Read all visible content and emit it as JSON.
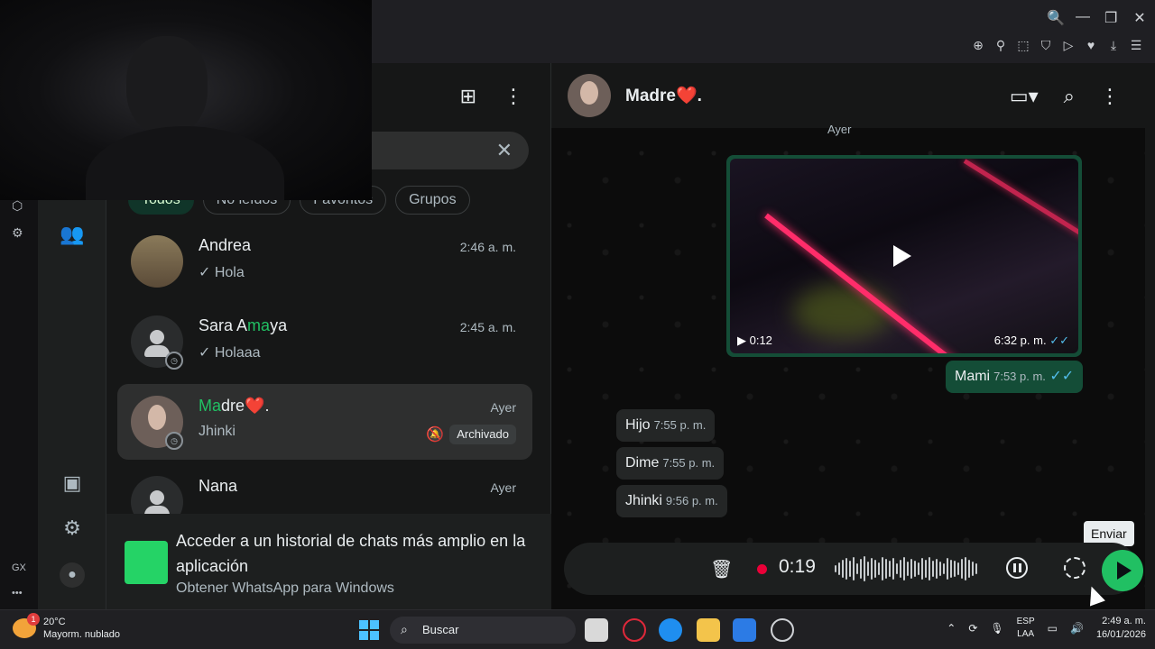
{
  "browser": {
    "window_controls": [
      "🔍",
      "—",
      "❐",
      "✕"
    ],
    "extension_icons": [
      "⊕",
      "⚲",
      "⬚",
      "⛉",
      "▷",
      "♥",
      "⤓",
      "☰"
    ]
  },
  "gx_sidebar": {
    "label": "GX",
    "more": "•••"
  },
  "chat_list": {
    "filters": [
      "Todos",
      "No leídos",
      "Favoritos",
      "Grupos"
    ],
    "chats": [
      {
        "name_prefix": "",
        "name_highlight": "",
        "name_suffix": "Andrea",
        "time": "2:46 a. m.",
        "preview": "✓ Hola"
      },
      {
        "name_prefix": "Sara A",
        "name_highlight": "ma",
        "name_suffix": "ya",
        "time": "2:45 a. m.",
        "preview": "✓ Holaaa"
      },
      {
        "name_prefix": "",
        "name_highlight": "Ma",
        "name_suffix": "dre❤️.",
        "time": "Ayer",
        "preview": "Jhinki",
        "badge": "Archivado"
      },
      {
        "name_prefix": "",
        "name_highlight": "",
        "name_suffix": "Nana",
        "time": "Ayer",
        "preview": ""
      }
    ],
    "promo": {
      "title": "Acceder a un historial de chats más amplio en la aplicación",
      "link": "Obtener WhatsApp para Windows"
    }
  },
  "conversation": {
    "contact_name": "Madre❤️.",
    "date_label": "Ayer",
    "video": {
      "duration": "0:12",
      "time": "6:32 p. m.",
      "ticks": "✓✓"
    },
    "messages": [
      {
        "text": "Mami",
        "time": "7:53 p. m.",
        "ticks": "✓✓",
        "direction": "out"
      },
      {
        "text": "Hijo",
        "time": "7:55 p. m.",
        "direction": "in"
      },
      {
        "text": "Dime",
        "time": "7:55 p. m.",
        "direction": "in"
      },
      {
        "text": "Jhinki",
        "time": "9:56 p. m.",
        "direction": "in"
      }
    ],
    "recording": {
      "elapsed": "0:19"
    },
    "send_tooltip": "Enviar"
  },
  "taskbar": {
    "weather": {
      "temp": "20°C",
      "condition": "Mayorm. nublado",
      "badge": "1"
    },
    "search_placeholder": "Buscar",
    "lang": [
      "ESP",
      "LAA"
    ],
    "time": "2:49 a. m.",
    "date": "16/01/2026"
  },
  "colors": {
    "accent": "#21c063",
    "outgoing_bubble": "#144d37",
    "incoming_bubble": "#242626",
    "read_ticks": "#53bdeb"
  }
}
